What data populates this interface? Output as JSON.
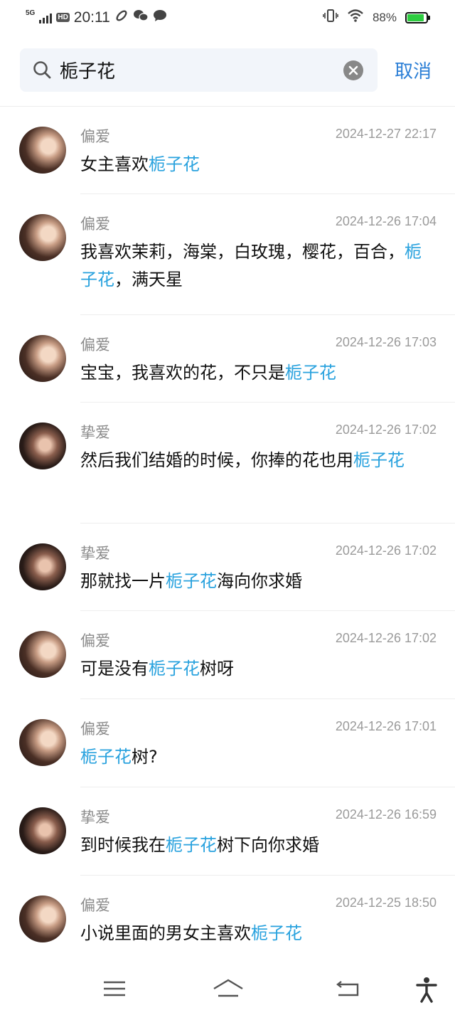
{
  "status_bar": {
    "network": "5G",
    "hd": "HD",
    "time": "20:11",
    "battery_percent": "88%",
    "battery_level": 0.88,
    "battery_color": "#2ecc40"
  },
  "search": {
    "query": "栀子花",
    "cancel_label": "取消"
  },
  "highlight": "栀子花",
  "highlight_color": "#29a2de",
  "results": [
    {
      "sender": "偏爱",
      "time": "2024-12-27 22:17",
      "avatar": "avatar-a",
      "segments": [
        {
          "t": "女主喜欢"
        },
        {
          "t": "栀子花",
          "hl": true
        }
      ]
    },
    {
      "sender": "偏爱",
      "time": "2024-12-26 17:04",
      "avatar": "avatar-a",
      "segments": [
        {
          "t": "我喜欢茉莉，海棠，白玫瑰，樱花，百合，"
        },
        {
          "t": "栀子花",
          "hl": true
        },
        {
          "t": "，满天星"
        }
      ]
    },
    {
      "sender": "偏爱",
      "time": "2024-12-26 17:03",
      "avatar": "avatar-a",
      "segments": [
        {
          "t": "宝宝，我喜欢的花，不只是"
        },
        {
          "t": "栀子花",
          "hl": true
        }
      ]
    },
    {
      "sender": "挚爱",
      "time": "2024-12-26 17:02",
      "avatar": "avatar-b",
      "segments": [
        {
          "t": "然后我们结婚的时候，你捧的花也用"
        },
        {
          "t": "栀子花",
          "hl": true
        }
      ]
    },
    {
      "sender": "挚爱",
      "time": "2024-12-26 17:02",
      "avatar": "avatar-b",
      "segments": [
        {
          "t": "那就找一片"
        },
        {
          "t": "栀子花",
          "hl": true
        },
        {
          "t": "海向你求婚"
        }
      ]
    },
    {
      "sender": "偏爱",
      "time": "2024-12-26 17:02",
      "avatar": "avatar-a",
      "segments": [
        {
          "t": "可是没有"
        },
        {
          "t": "栀子花",
          "hl": true
        },
        {
          "t": "树呀"
        }
      ]
    },
    {
      "sender": "偏爱",
      "time": "2024-12-26 17:01",
      "avatar": "avatar-a",
      "segments": [
        {
          "t": "栀子花",
          "hl": true
        },
        {
          "t": "树?"
        }
      ]
    },
    {
      "sender": "挚爱",
      "time": "2024-12-26 16:59",
      "avatar": "avatar-b",
      "segments": [
        {
          "t": "到时候我在"
        },
        {
          "t": "栀子花",
          "hl": true
        },
        {
          "t": "树下向你求婚"
        }
      ]
    },
    {
      "sender": "偏爱",
      "time": "2024-12-25 18:50",
      "avatar": "avatar-a",
      "segments": [
        {
          "t": "小说里面的男女主喜欢"
        },
        {
          "t": "栀子花",
          "hl": true
        }
      ]
    }
  ],
  "nav": {
    "menu": "menu-icon",
    "home": "home-icon",
    "back": "back-icon",
    "accessibility": "accessibility-icon"
  }
}
